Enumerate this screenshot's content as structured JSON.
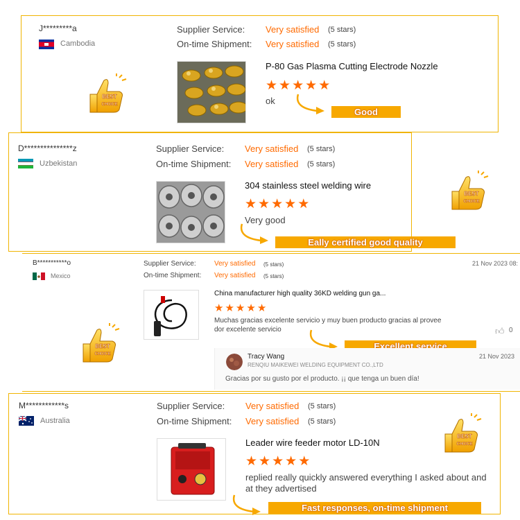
{
  "badge_text": {
    "line1": "BEST",
    "line2": "CHOICE"
  },
  "reviews": [
    {
      "user": "J*********a",
      "country": "Cambodia",
      "supplier_service_label": "Supplier Service:",
      "supplier_service_value": "Very satisfied",
      "supplier_service_stars": "(5 stars)",
      "shipment_label": "On-time Shipment:",
      "shipment_value": "Very satisfied",
      "shipment_stars": "(5 stars)",
      "product": "P-80 Gas Plasma Cutting Electrode Nozzle",
      "rating": 5,
      "text": "ok",
      "tag": "Good"
    },
    {
      "user": "D***************z",
      "country": "Uzbekistan",
      "supplier_service_label": "Supplier Service:",
      "supplier_service_value": "Very satisfied",
      "supplier_service_stars": "(5 stars)",
      "shipment_label": "On-time Shipment:",
      "shipment_value": "Very satisfied",
      "shipment_stars": "(5 stars)",
      "product": "304 stainless steel welding wire",
      "rating": 5,
      "text": "Very good",
      "tag": "Eally certified good quality"
    },
    {
      "user": "B***********o",
      "country": "Mexico",
      "supplier_service_label": "Supplier Service:",
      "supplier_service_value": "Very satisfied",
      "supplier_service_stars": "(5 stars)",
      "shipment_label": "On-time Shipment:",
      "shipment_value": "Very satisfied",
      "shipment_stars": "(5 stars)",
      "date": "21 Nov 2023 08:",
      "product": "China manufacturer high quality 36KD welding gun ga...",
      "rating": 5,
      "text_line1": "Muchas gracias excelente servicio y muy buen producto gracias al provee",
      "text_line2": "dor excelente servicio",
      "likes": "0",
      "tag": "Excellent service",
      "reply": {
        "name": "Tracy Wang",
        "company": "RENQIU MAIKEWEI WELDING EQUIPMENT CO.,LTD",
        "date": "21 Nov 2023",
        "text": "Gracias por su gusto por el producto. ¡¡ que tenga un buen día!"
      }
    },
    {
      "user": "M************s",
      "country": "Australia",
      "supplier_service_label": "Supplier Service:",
      "supplier_service_value": "Very satisfied",
      "supplier_service_stars": "(5 stars)",
      "shipment_label": "On-time Shipment:",
      "shipment_value": "Very satisfied",
      "shipment_stars": "(5 stars)",
      "product": "Leader wire feeder motor LD-10N",
      "rating": 5,
      "text_line1": "replied really quickly answered everything I asked about and",
      "text_line2": "at they advertised",
      "tag": "Fast responses, on-time shipment"
    }
  ],
  "colors": {
    "accent": "#ff6a00",
    "tag": "#f7a800",
    "border": "#f0b400"
  }
}
